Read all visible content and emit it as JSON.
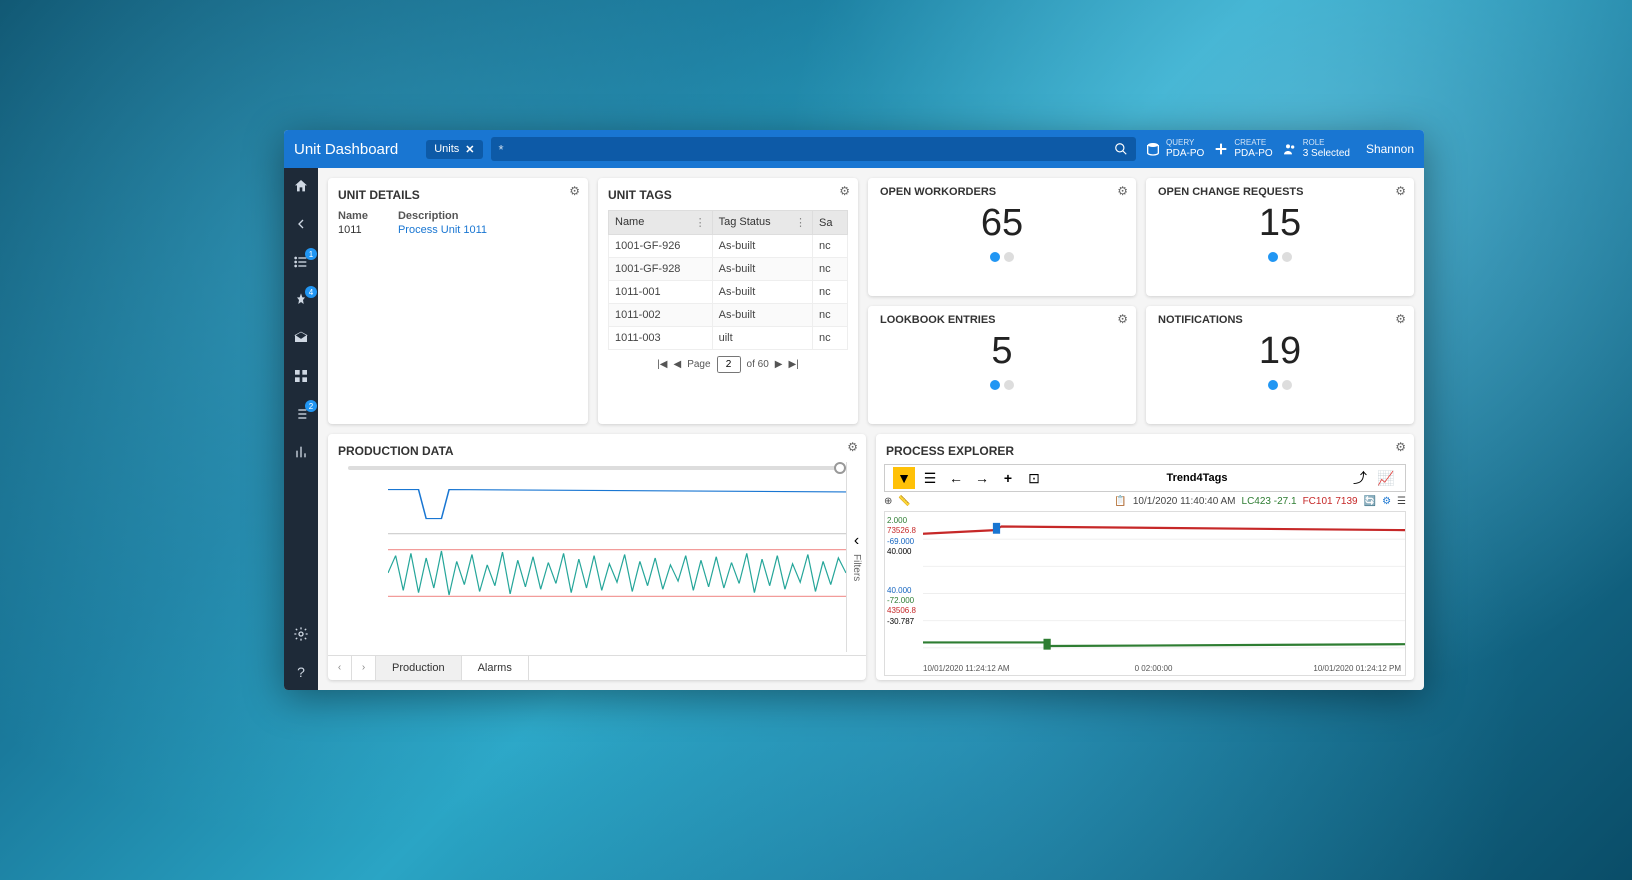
{
  "header": {
    "title": "Unit Dashboard",
    "chip": "Units",
    "search_placeholder": "*",
    "query_label": "QUERY",
    "query_value": "PDA-PO",
    "create_label": "CREATE",
    "create_value": "PDA-PO",
    "role_label": "ROLE",
    "role_value": "3 Selected",
    "user": "Shannon"
  },
  "sidebar": {
    "badges": {
      "list1": "1",
      "pin": "4",
      "list2": "2"
    }
  },
  "unit_details": {
    "title": "UNIT DETAILS",
    "name_label": "Name",
    "name_value": "1011",
    "desc_label": "Description",
    "desc_value": "Process Unit 1011"
  },
  "unit_tags": {
    "title": "UNIT TAGS",
    "columns": [
      "Name",
      "Tag Status",
      "Sa"
    ],
    "rows": [
      {
        "name": "1001-GF-926",
        "status": "As-built",
        "s": "nc"
      },
      {
        "name": "1001-GF-928",
        "status": "As-built",
        "s": "nc"
      },
      {
        "name": "1011-001",
        "status": "As-built",
        "s": "nc"
      },
      {
        "name": "1011-002",
        "status": "As-built",
        "s": "nc"
      },
      {
        "name": "1011-003",
        "status": "uilt",
        "s": "nc"
      }
    ],
    "pager": {
      "page_label": "Page",
      "page": "2",
      "total_label": "of 60"
    }
  },
  "metrics": {
    "workorders": {
      "title": "OPEN WORKORDERS",
      "value": "65"
    },
    "change_requests": {
      "title": "OPEN CHANGE REQUESTS",
      "value": "15"
    },
    "lookbook": {
      "title": "LOOKBOOK ENTRIES",
      "value": "5"
    },
    "notifications": {
      "title": "NOTIFICATIONS",
      "value": "19"
    }
  },
  "production": {
    "title": "PRODUCTION DATA",
    "tabs": [
      "Production",
      "Alarms"
    ],
    "filters_label": "Filters"
  },
  "process_explorer": {
    "title": "PROCESS EXPLORER",
    "trend_title": "Trend4Tags",
    "timestamp": "10/1/2020 11:40:40 AM",
    "tag1": "LC423 -27.1",
    "tag2": "FC101 7139",
    "ylabels": [
      "2.000",
      "73526.8",
      "-69.000",
      "40.000",
      "40.000",
      "-72.000",
      "43506.8",
      "-30.787"
    ],
    "xlabels": [
      "10/01/2020 11:24:12 AM",
      "0 02:00:00",
      "10/01/2020 01:24:12 PM"
    ]
  }
}
